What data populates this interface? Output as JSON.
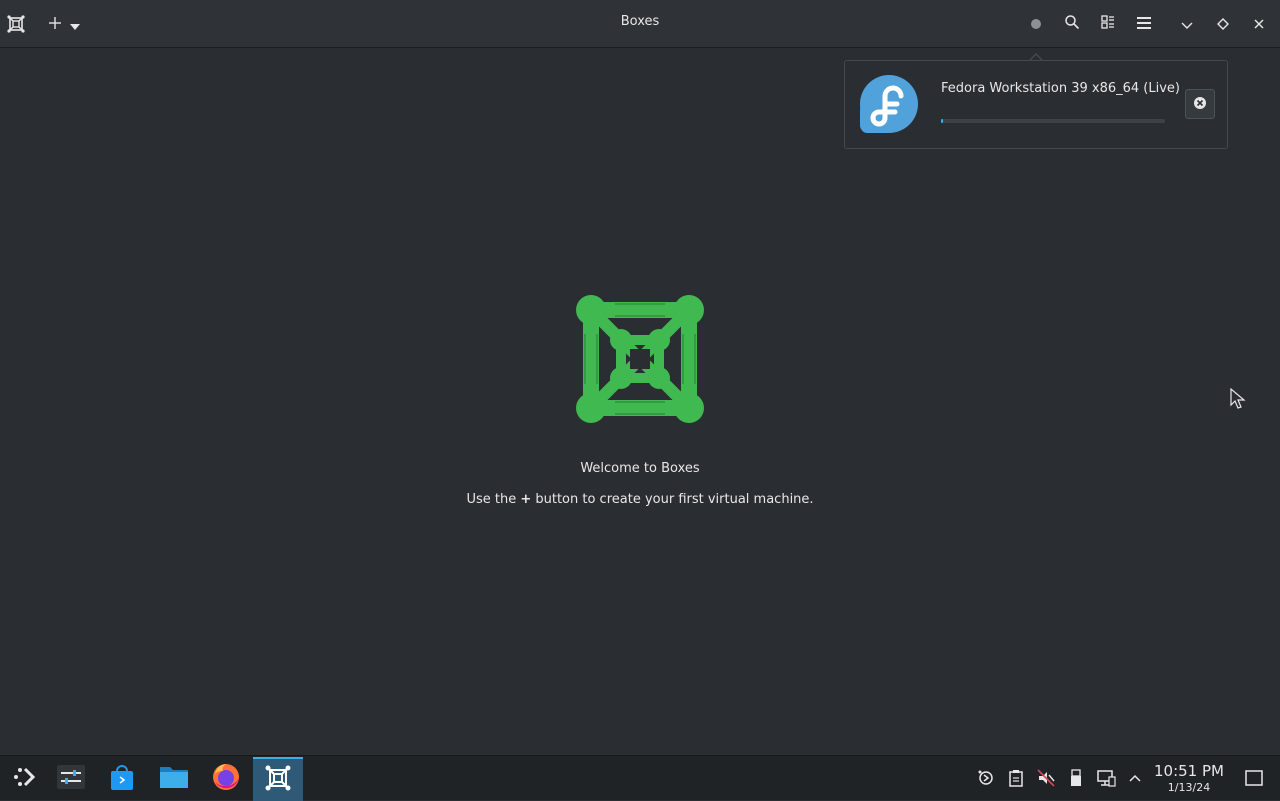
{
  "window": {
    "title": "Boxes"
  },
  "download": {
    "name": "Fedora Workstation 39 x86_64 (Live)",
    "progress_percent": 1
  },
  "empty_state": {
    "title": "Welcome to Boxes",
    "hint_before": "Use the ",
    "hint_plus": "+",
    "hint_after": " button to create your first virtual machine."
  },
  "taskbar": {
    "time": "10:51 PM",
    "date": "1/13/24"
  },
  "colors": {
    "accent": "#3daee9",
    "logo_green": "#3fb950",
    "fedora_blue": "#51a2da"
  },
  "icons": {
    "app": "boxes-icon",
    "new": "plus-icon",
    "downloads": "downloads-indicator-icon",
    "search": "search-icon",
    "view": "view-mode-icon",
    "menu": "hamburger-menu-icon",
    "minimize": "chevron-down-icon",
    "maximize": "diamond-icon",
    "close": "close-icon"
  }
}
